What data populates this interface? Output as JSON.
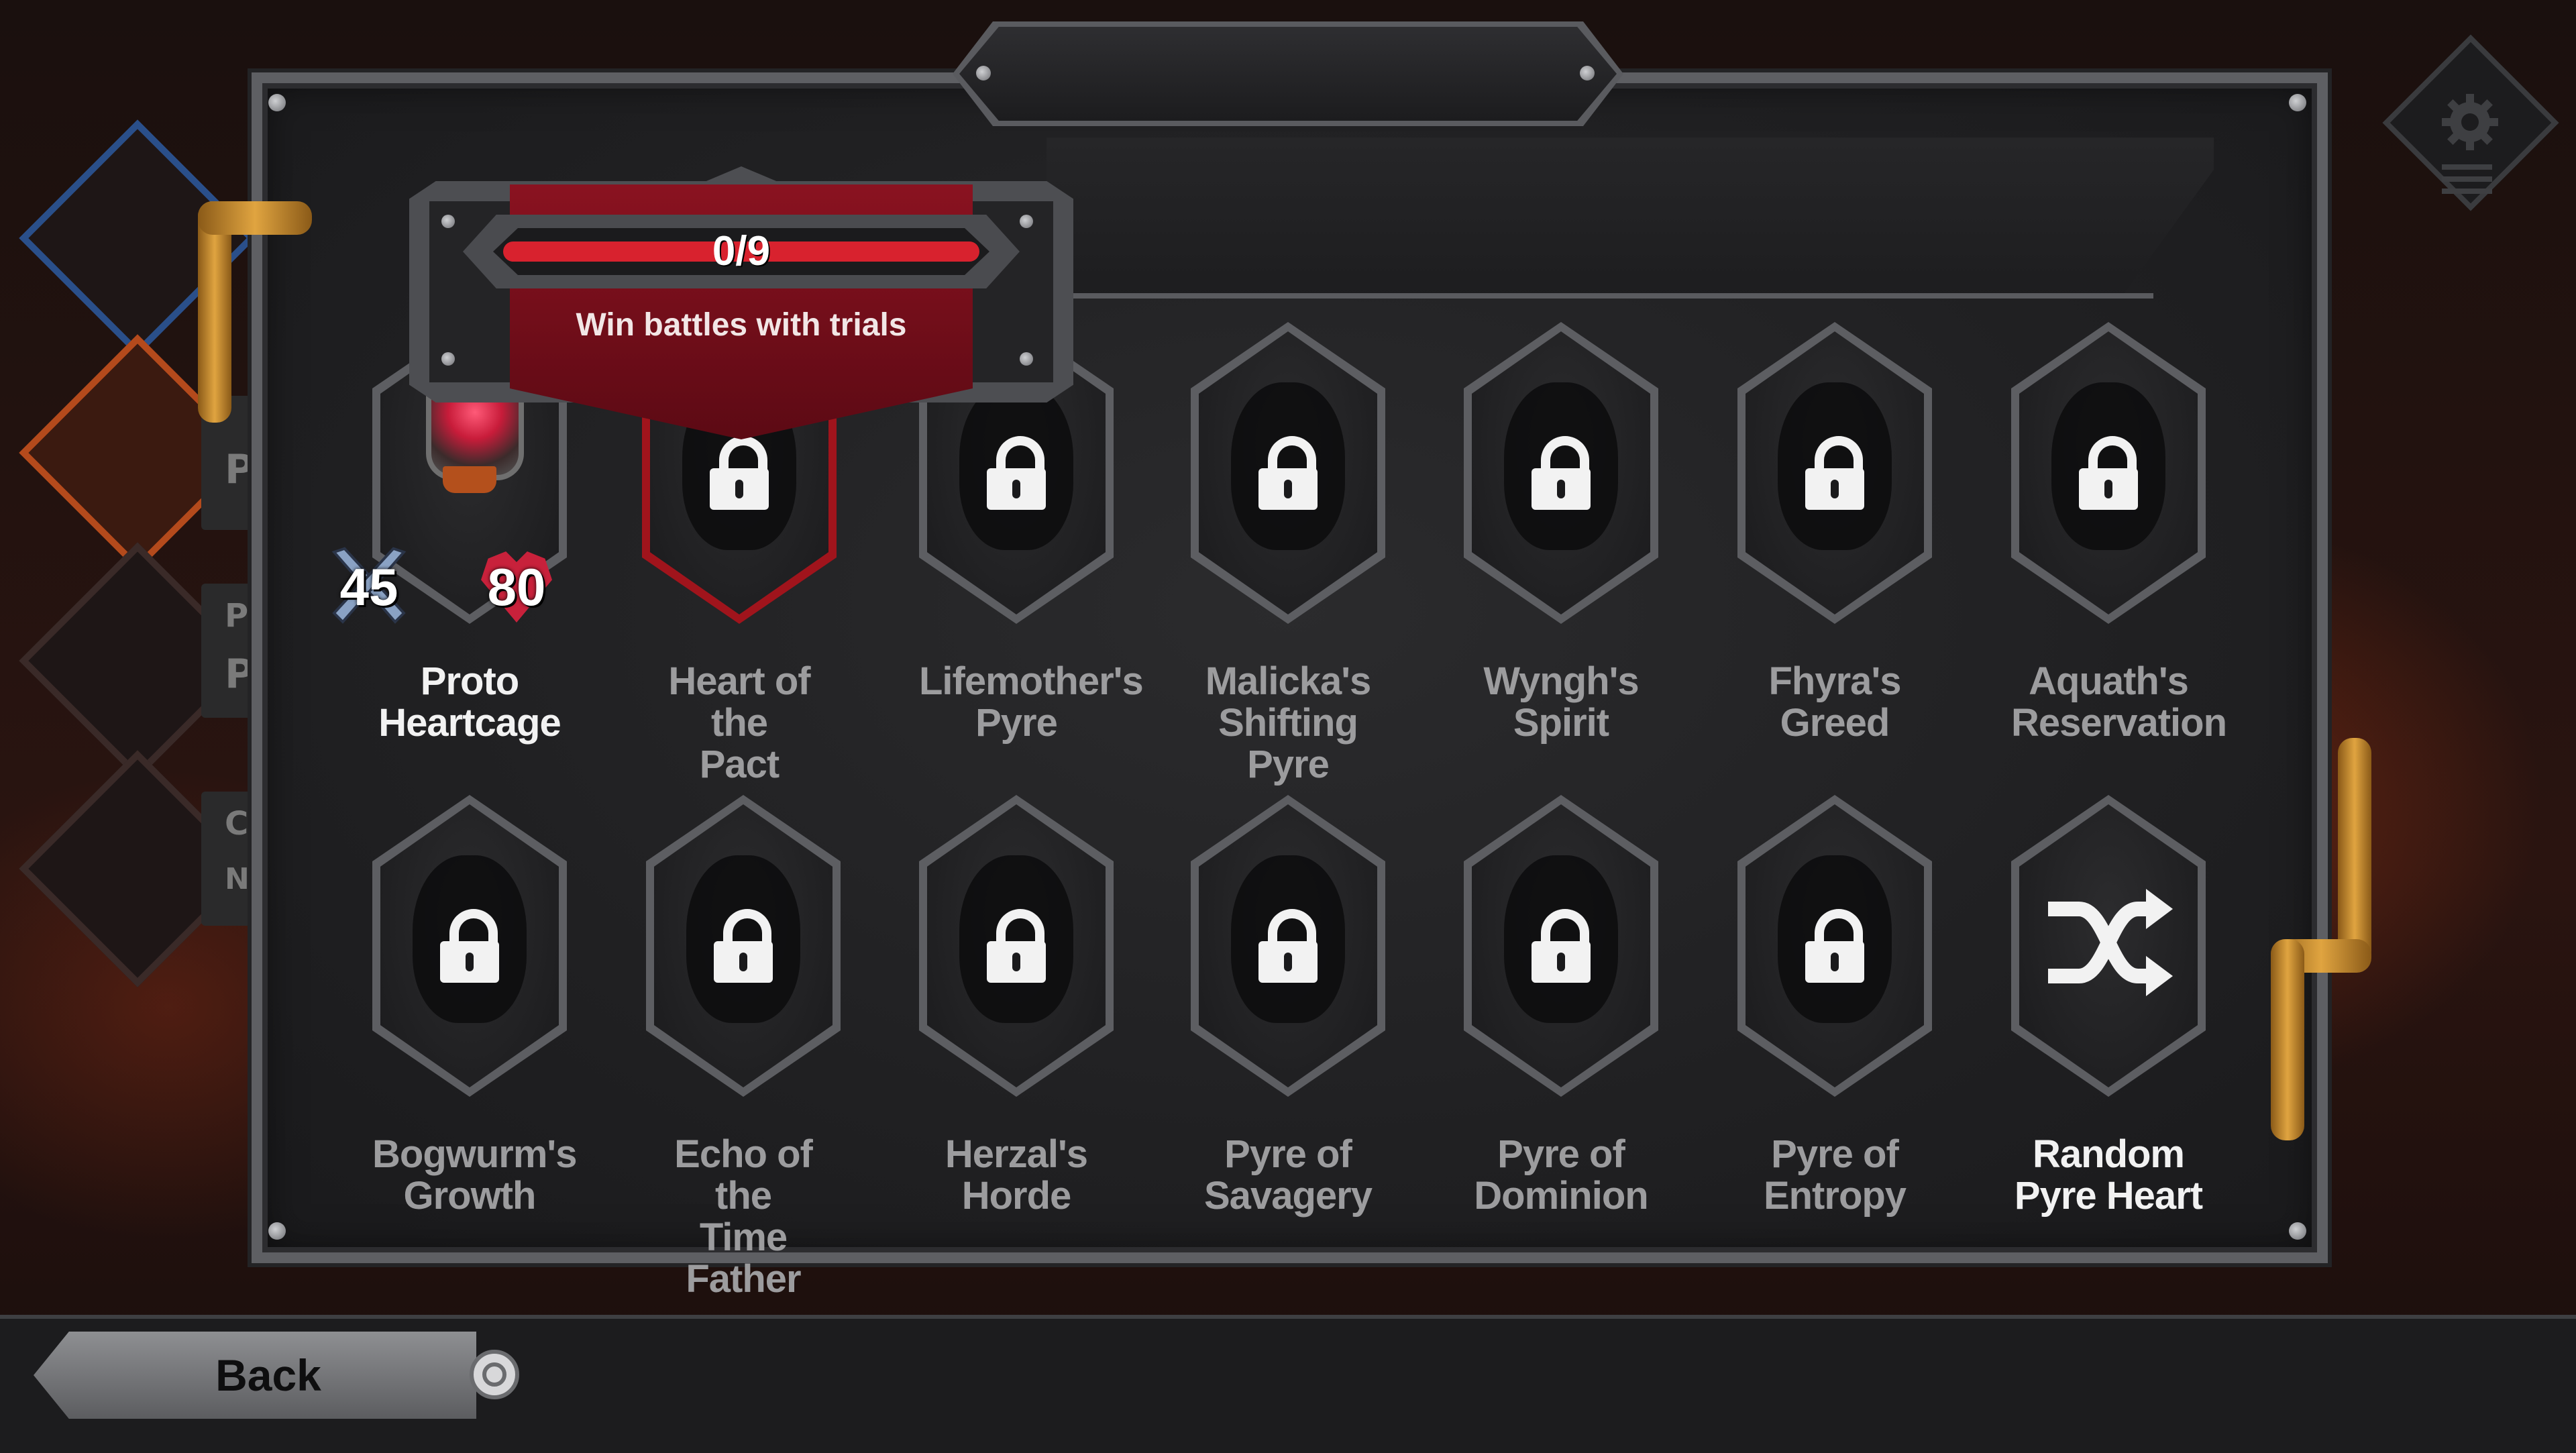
{
  "progress": {
    "text": "0/9",
    "current": 0,
    "total": 9,
    "fill_fraction": 0.0
  },
  "tooltip": {
    "description": "Win battles with trials"
  },
  "selected_slot": {
    "name_line1": "Proto",
    "name_line2": "Heartcage",
    "attack": "45",
    "health": "80"
  },
  "row1": [
    {
      "line1": "Heart of the",
      "line2": "Pact",
      "state": "locked",
      "selected": true,
      "icon": "lock-icon"
    },
    {
      "line1": "Lifemother's",
      "line2": "Pyre",
      "state": "locked",
      "icon": "lock-icon"
    },
    {
      "line1": "Malicka's",
      "line2": "Shifting Pyre",
      "state": "locked",
      "icon": "lock-icon"
    },
    {
      "line1": "Wyngh's",
      "line2": "Spirit",
      "state": "locked",
      "icon": "lock-icon"
    },
    {
      "line1": "Fhyra's",
      "line2": "Greed",
      "state": "locked",
      "icon": "lock-icon"
    },
    {
      "line1": "Aquath's",
      "line2": "Reservation",
      "state": "locked",
      "icon": "lock-icon"
    }
  ],
  "row2": [
    {
      "line1": "Bogwurm's",
      "line2": "Growth",
      "state": "locked",
      "icon": "lock-icon"
    },
    {
      "line1": "Echo of the",
      "line2": "Time Father",
      "state": "locked",
      "icon": "lock-icon"
    },
    {
      "line1": "Herzal's",
      "line2": "Horde",
      "state": "locked",
      "icon": "lock-icon"
    },
    {
      "line1": "Pyre of",
      "line2": "Savagery",
      "state": "locked",
      "icon": "lock-icon"
    },
    {
      "line1": "Pyre of",
      "line2": "Dominion",
      "state": "locked",
      "icon": "lock-icon"
    },
    {
      "line1": "Pyre of",
      "line2": "Entropy",
      "state": "locked",
      "icon": "lock-icon"
    },
    {
      "line1": "Random",
      "line2": "Pyre Heart",
      "state": "available",
      "icon": "shuffle-icon"
    }
  ],
  "background_side_letters": [
    "P",
    "P",
    "P",
    "C",
    "N"
  ],
  "bottom_bar": {
    "back_label": "Back",
    "back_button_glyph": "circle-button-icon"
  },
  "colors": {
    "accent_red": "#c81c2a",
    "label_active": "#f2f2f2",
    "label_locked": "#9c9c9e",
    "frame_gray": "#5d5e62",
    "pipe_copper": "#d89a3c"
  }
}
